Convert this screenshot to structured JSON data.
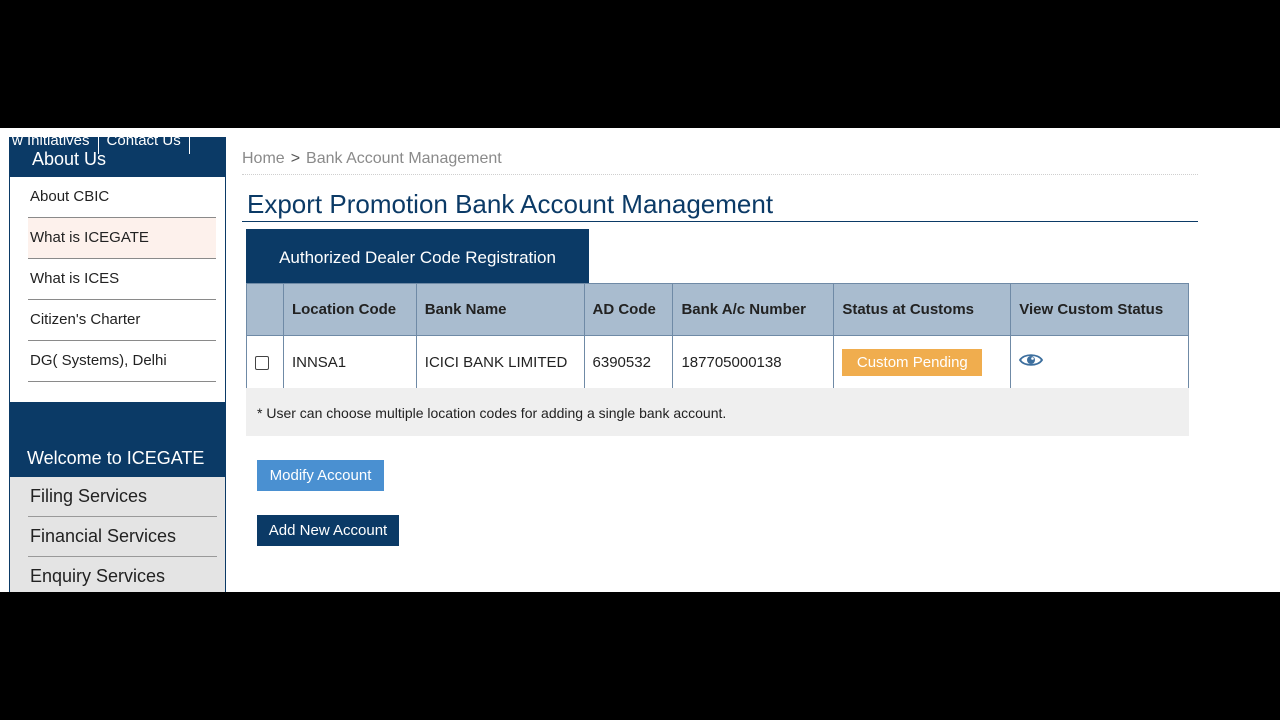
{
  "top_links": [
    "w Initiatives",
    "Contact Us"
  ],
  "sidebar": {
    "about_title": "About Us",
    "about_items": [
      {
        "label": "About CBIC"
      },
      {
        "label": "What is ICEGATE"
      },
      {
        "label": "What is ICES"
      },
      {
        "label": "Citizen's Charter"
      },
      {
        "label": "DG( Systems), Delhi"
      }
    ],
    "welcome_title": "Welcome to ICEGATE",
    "services": [
      {
        "label": "Filing Services"
      },
      {
        "label": "Financial Services"
      },
      {
        "label": "Enquiry Services"
      }
    ]
  },
  "breadcrumb": {
    "home": "Home",
    "separator": ">",
    "current": "Bank Account Management"
  },
  "page_title": "Export Promotion Bank Account Management",
  "tab_label": "Authorized Dealer Code Registration",
  "table": {
    "headers": [
      "Location Code",
      "Bank Name",
      "AD Code",
      "Bank A/c Number",
      "Status at Customs",
      "View Custom Status"
    ],
    "rows": [
      {
        "location_code": "INNSA1",
        "bank_name": "ICICI BANK LIMITED",
        "ad_code": "6390532",
        "account_number": "187705000138",
        "status": "Custom Pending"
      }
    ]
  },
  "note": "* User can choose multiple location codes for adding a single bank account.",
  "buttons": {
    "modify": "Modify Account",
    "add": "Add New Account"
  },
  "colors": {
    "brand": "#0b3a66",
    "table_header": "#a9bccf",
    "status_pending": "#f0ad4e",
    "modify_button": "#4a90d1"
  },
  "icons": {
    "view_status": "eye-icon"
  }
}
